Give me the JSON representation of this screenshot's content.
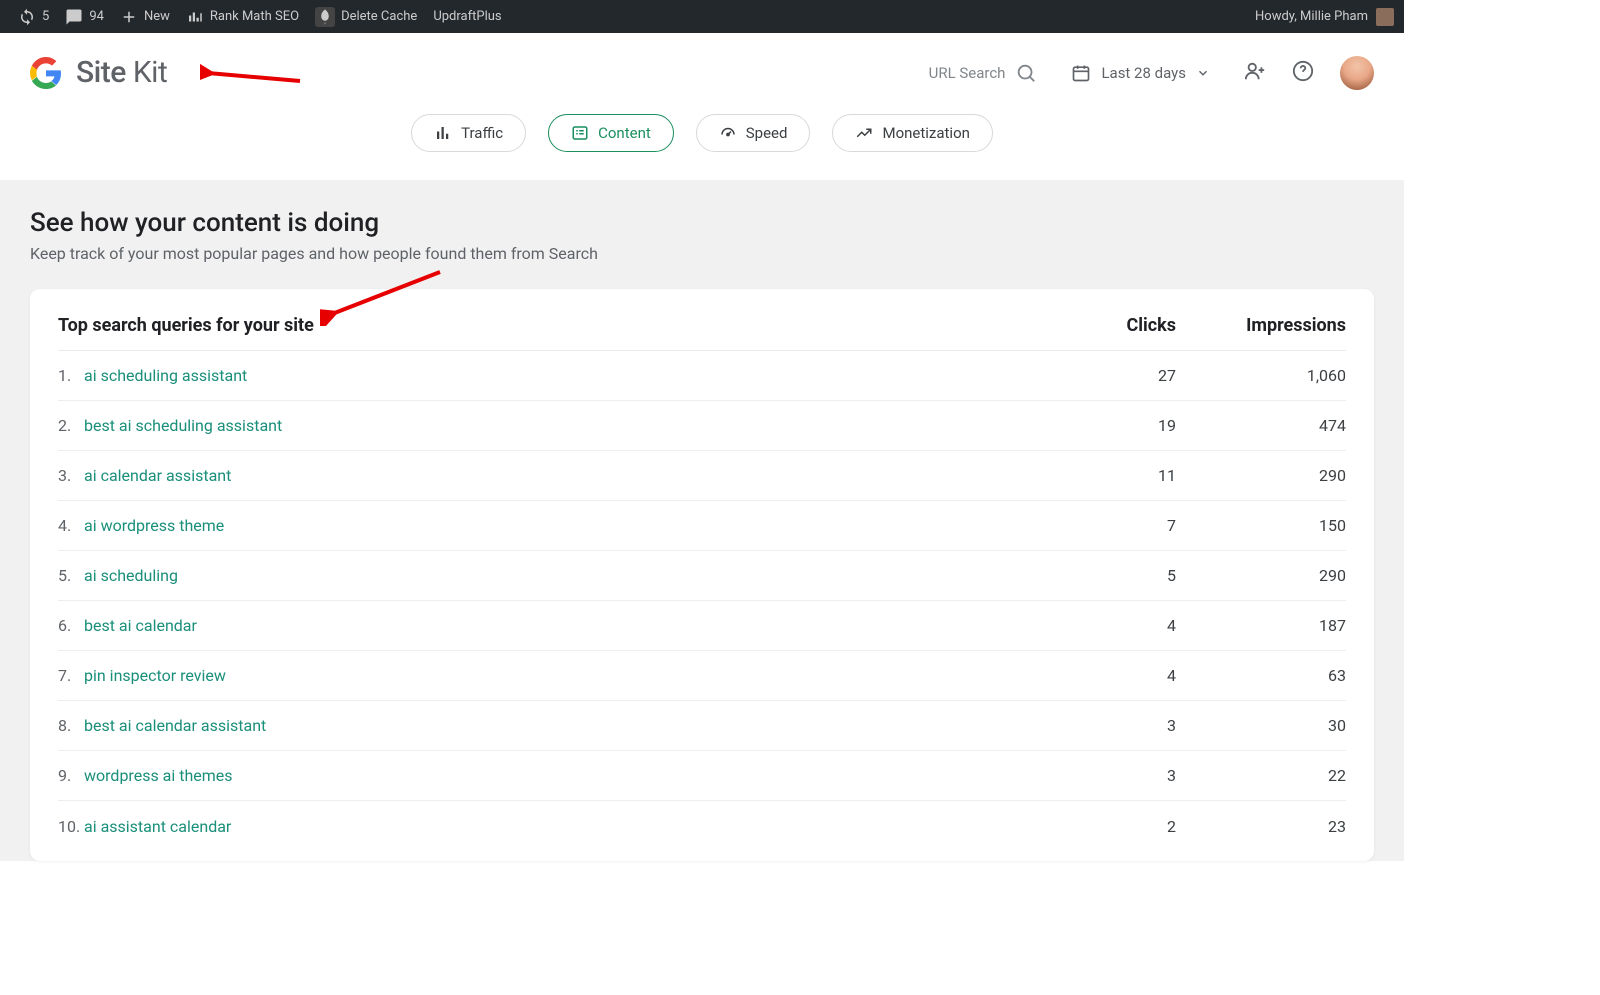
{
  "adminbar": {
    "refresh": "5",
    "comments": "94",
    "new": "New",
    "rankmath": "Rank Math SEO",
    "deletecache": "Delete Cache",
    "updraft": "UpdraftPlus",
    "howdy": "Howdy, Millie Pham"
  },
  "header": {
    "brand_site": "Site",
    "brand_kit": "Kit",
    "url_search": "URL Search",
    "date_range": "Last 28 days"
  },
  "tabs": {
    "traffic": "Traffic",
    "content": "Content",
    "speed": "Speed",
    "monetization": "Monetization"
  },
  "section": {
    "title": "See how your content is doing",
    "subtitle": "Keep track of your most popular pages and how people found them from Search"
  },
  "table": {
    "title": "Top search queries for your site",
    "col_clicks": "Clicks",
    "col_impressions": "Impressions",
    "rows": [
      {
        "i": "1.",
        "q": "ai scheduling assistant",
        "clicks": "27",
        "impr": "1,060"
      },
      {
        "i": "2.",
        "q": "best ai scheduling assistant",
        "clicks": "19",
        "impr": "474"
      },
      {
        "i": "3.",
        "q": "ai calendar assistant",
        "clicks": "11",
        "impr": "290"
      },
      {
        "i": "4.",
        "q": "ai wordpress theme",
        "clicks": "7",
        "impr": "150"
      },
      {
        "i": "5.",
        "q": "ai scheduling",
        "clicks": "5",
        "impr": "290"
      },
      {
        "i": "6.",
        "q": "best ai calendar",
        "clicks": "4",
        "impr": "187"
      },
      {
        "i": "7.",
        "q": "pin inspector review",
        "clicks": "4",
        "impr": "63"
      },
      {
        "i": "8.",
        "q": "best ai calendar assistant",
        "clicks": "3",
        "impr": "30"
      },
      {
        "i": "9.",
        "q": "wordpress ai themes",
        "clicks": "3",
        "impr": "22"
      },
      {
        "i": "10.",
        "q": "ai assistant calendar",
        "clicks": "2",
        "impr": "23"
      }
    ]
  }
}
